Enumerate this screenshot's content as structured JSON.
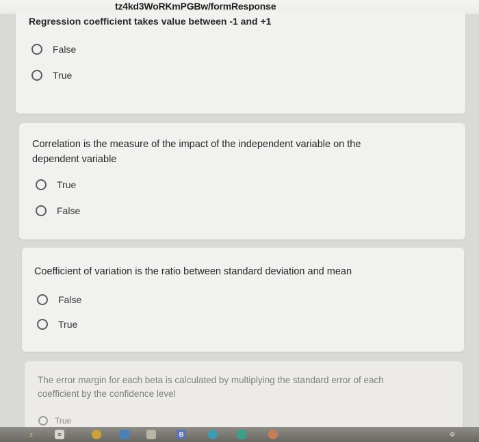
{
  "browser": {
    "url_fragment": "tz4kd3WoRKmPGBw/formResponse"
  },
  "questions": [
    {
      "title": "Regression coefficient takes value between -1 and +1",
      "options": [
        "False",
        "True"
      ]
    },
    {
      "title": "Correlation is the measure of the impact of the independent variable on the dependent variable",
      "options": [
        "True",
        "False"
      ]
    },
    {
      "title": "Coefficient of variation is the ratio between standard deviation and mean",
      "options": [
        "False",
        "True"
      ]
    },
    {
      "title": "The error margin for each beta is calculated by multiplying the standard error of each coefficient by the confidence level",
      "options": [
        "True"
      ]
    }
  ],
  "taskbar": {
    "icons": [
      "launcher-icon",
      "files-icon",
      "chrome-icon",
      "docs-icon",
      "store-icon",
      "b-icon",
      "edge-icon",
      "play-icon",
      "camera-icon",
      "settings-icon"
    ],
    "b_label": "B"
  },
  "colors": {
    "page_background": "#d9dad8",
    "card_background": "#f1f1ef",
    "radio_border": "#5c5c5c"
  }
}
